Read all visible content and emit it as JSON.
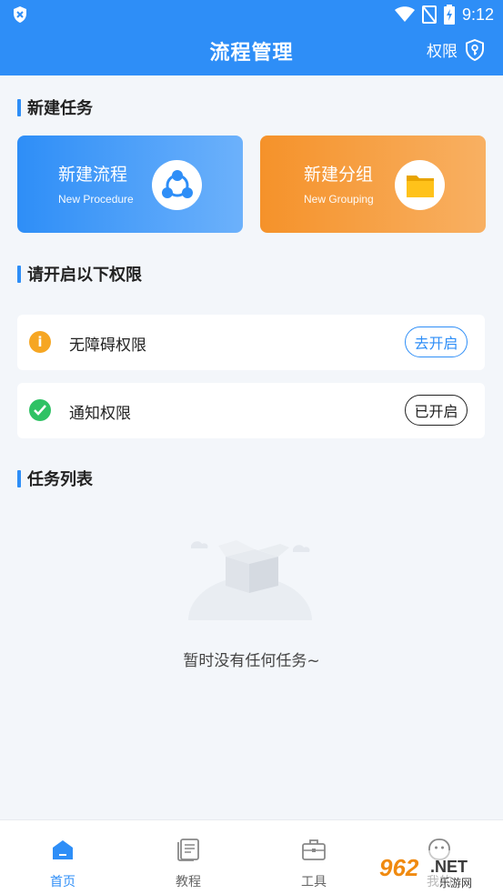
{
  "status": {
    "time": "9:12"
  },
  "header": {
    "title": "流程管理",
    "permission_label": "权限"
  },
  "new_task": {
    "section_title": "新建任务",
    "cards": [
      {
        "title": "新建流程",
        "subtitle": "New Procedure",
        "color": "#2e8ef7",
        "icon": "share-nodes-icon"
      },
      {
        "title": "新建分组",
        "subtitle": "New Grouping",
        "color": "#f5922a",
        "icon": "folder-icon"
      }
    ]
  },
  "permissions": {
    "section_title": "请开启以下权限",
    "items": [
      {
        "label": "无障碍权限",
        "status_icon": "info-icon",
        "button": "去开启",
        "icon_color": "#f6a623"
      },
      {
        "label": "通知权限",
        "status_icon": "check-icon",
        "button": "已开启",
        "icon_color": "#2fc264"
      }
    ]
  },
  "task_list": {
    "section_title": "任务列表",
    "empty_text": "暂时没有任何任务~"
  },
  "tabbar": {
    "items": [
      {
        "label": "首页",
        "icon": "home-icon",
        "active": true
      },
      {
        "label": "教程",
        "icon": "book-icon",
        "active": false
      },
      {
        "label": "工具",
        "icon": "toolbox-icon",
        "active": false
      },
      {
        "label": "我的",
        "icon": "user-icon",
        "active": false
      }
    ]
  },
  "watermark": {
    "text_top": "962",
    "text_net": ".NET",
    "text_bottom": "乐游网"
  },
  "colors": {
    "primary": "#2e8ef7",
    "accent": "#f5922a",
    "background": "#f3f6fa"
  }
}
